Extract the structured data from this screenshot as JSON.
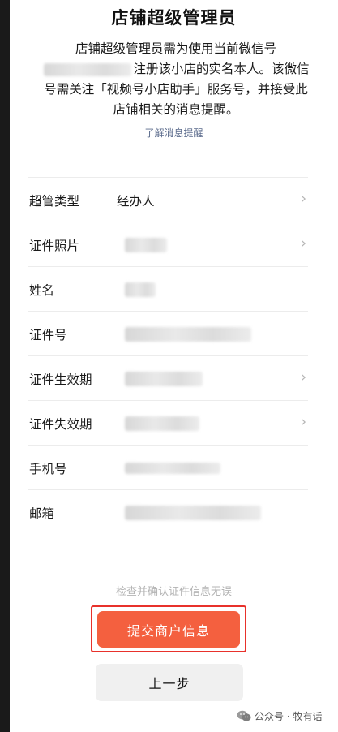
{
  "header": {
    "title": "店铺超级管理员",
    "desc_part1": "店铺超级管理员需为使用当前微信号",
    "desc_part2": "注册该小店的实名本人。该微信号需关注「视频号小店助手」服务号，并接受此店铺相关的消息提醒。",
    "learn_link": "了解消息提醒"
  },
  "form": {
    "rows": [
      {
        "label": "超管类型",
        "value": "经办人"
      },
      {
        "label": "证件照片"
      },
      {
        "label": "姓名"
      },
      {
        "label": "证件号"
      },
      {
        "label": "证件生效期"
      },
      {
        "label": "证件失效期"
      },
      {
        "label": "手机号"
      },
      {
        "label": "邮箱"
      }
    ]
  },
  "footer": {
    "hint": "检查并确认证件信息无误",
    "submit_label": "提交商户信息",
    "prev_label": "上一步"
  },
  "watermark": {
    "text": "公众号 · 牧有话"
  },
  "colors": {
    "accent": "#f4603f",
    "highlight_border": "#e8312b",
    "link": "#5b6b8c"
  }
}
